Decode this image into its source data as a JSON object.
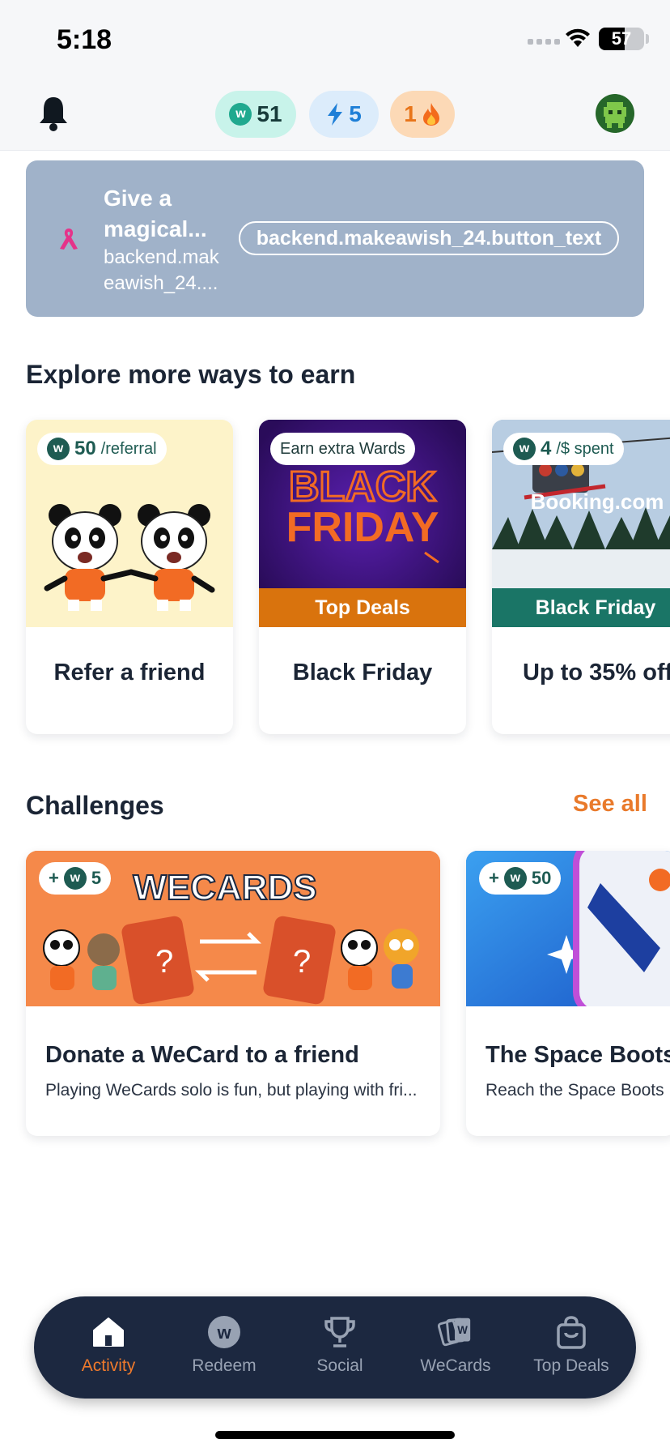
{
  "status_bar": {
    "time": "5:18",
    "battery_level": "57",
    "battery_fraction": 0.57
  },
  "header": {
    "wards_balance": "51",
    "coin_symbol": "w",
    "energy": "5",
    "streak": "1"
  },
  "wish_banner": {
    "title": "Give a magical...",
    "subtitle": "backend.makeawish_24....",
    "button_text": "backend.makeawish_24.button_text"
  },
  "earn_section": {
    "title": "Explore more ways to earn",
    "cards": [
      {
        "badge_value": "50",
        "badge_unit": "/referral",
        "label": "Refer a friend"
      },
      {
        "badge_text": "Earn extra Wards",
        "band": "Top Deals",
        "art_line1": "BLACK",
        "art_line2": "FRIDAY",
        "label": "Black Friday"
      },
      {
        "badge_value": "4",
        "badge_unit": "/$ spent",
        "art_brand": "Booking.com",
        "band": "Black Friday",
        "label": "Up to 35% off"
      }
    ]
  },
  "challenges": {
    "title": "Challenges",
    "see_all": "See all",
    "cards": [
      {
        "reward_prefix": "+",
        "reward": "5",
        "art_title": "WECARDS",
        "title": "Donate a WeCard to a friend",
        "description": "Playing WeCards solo is fun, but playing with fri..."
      },
      {
        "reward_prefix": "+",
        "reward": "50",
        "title": "The Space Boots",
        "description": "Reach the Space Boots L"
      }
    ]
  },
  "bottom_nav": {
    "active": "Activity",
    "items": [
      {
        "label": "Activity",
        "icon": "home-icon"
      },
      {
        "label": "Redeem",
        "icon": "wards-coin-icon"
      },
      {
        "label": "Social",
        "icon": "trophy-icon"
      },
      {
        "label": "WeCards",
        "icon": "cards-icon"
      },
      {
        "label": "Top Deals",
        "icon": "shopping-bag-icon"
      }
    ]
  },
  "colors": {
    "accent": "#EF7A2C",
    "nav_background": "#1C2840",
    "banner_background": "#A0B2C9",
    "wards_green": "#20A98F"
  }
}
